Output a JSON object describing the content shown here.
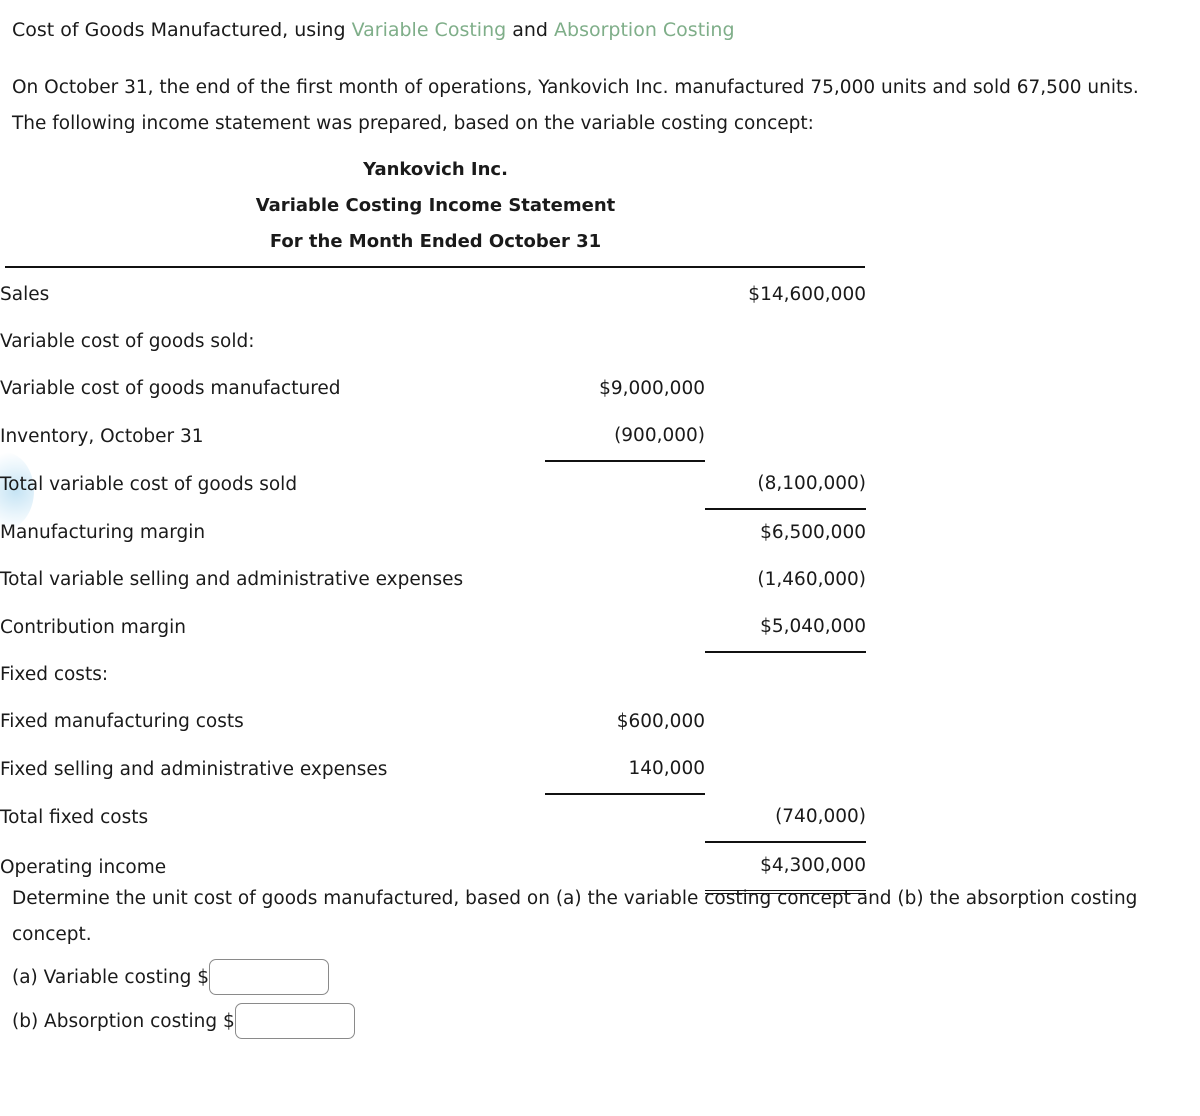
{
  "prompt": {
    "lead": "Cost of Goods Manufactured, using ",
    "term1": "Variable Costing",
    "conjunction": " and ",
    "term2": "Absorption Costing",
    "accent_color": "#7fae89"
  },
  "intro": {
    "text": "On October 31, the end of the first month of operations, Yankovich Inc. manufactured 75,000 units and sold 67,500 units. The following income statement was prepared, based on the variable costing concept:"
  },
  "statement": {
    "company": "Yankovich Inc.",
    "title": "Variable Costing Income Statement",
    "period": "For the Month Ended October 31",
    "rows": [
      {
        "label": "Sales",
        "indent": 0,
        "col1": "",
        "col2": "$14,600,000"
      },
      {
        "label": "Variable cost of goods sold:",
        "indent": 0,
        "col1": "",
        "col2": ""
      },
      {
        "label": "Variable cost of goods manufactured",
        "indent": 1,
        "col1": "$9,000,000",
        "col2": ""
      },
      {
        "label": "Inventory, October 31",
        "indent": 1,
        "col1": "(900,000)",
        "col2": ""
      },
      {
        "label": "Total variable cost of goods sold",
        "indent": 2,
        "col1": "",
        "col2": "(8,100,000)"
      },
      {
        "label": "Manufacturing margin",
        "indent": 0,
        "col1": "",
        "col2": "$6,500,000"
      },
      {
        "label": "Total variable selling and administrative expenses",
        "indent": 0,
        "col1": "",
        "col2": "(1,460,000)"
      },
      {
        "label": "Contribution margin",
        "indent": 0,
        "col1": "",
        "col2": "$5,040,000"
      },
      {
        "label": "Fixed costs:",
        "indent": 0,
        "col1": "",
        "col2": ""
      },
      {
        "label": "Fixed manufacturing costs",
        "indent": 1,
        "col1": "$600,000",
        "col2": ""
      },
      {
        "label": "Fixed selling and administrative expenses",
        "indent": 1,
        "col1": "140,000",
        "col2": ""
      },
      {
        "label": "Total fixed costs",
        "indent": 2,
        "col1": "",
        "col2": "(740,000)"
      },
      {
        "label": "Operating income",
        "indent": 1,
        "col1": "",
        "col2": "$4,300,000"
      }
    ]
  },
  "question": {
    "text": "Determine the unit cost of goods manufactured, based on (a) the variable costing concept and (b) the absorption costing concept."
  },
  "answers": [
    {
      "label": "(a) Variable costing $",
      "value": "",
      "placeholder": ""
    },
    {
      "label": "(b) Absorption costing $",
      "value": "",
      "placeholder": ""
    }
  ]
}
